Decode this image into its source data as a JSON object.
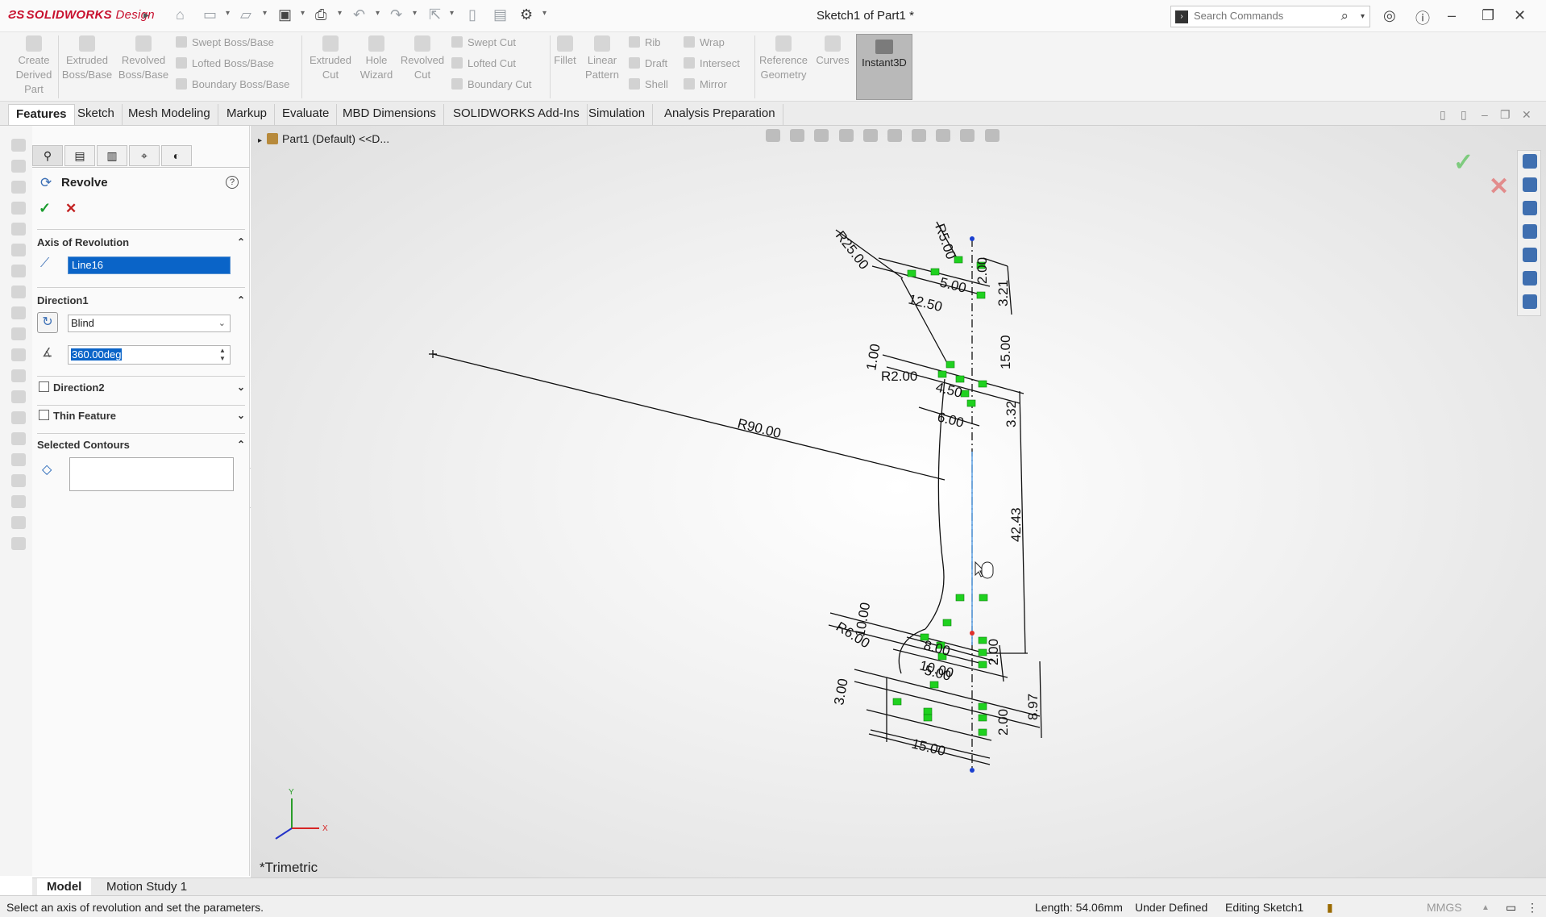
{
  "app": {
    "logo": "SOLIDWORKS",
    "logo_suffix": "Design",
    "document_title": "Sketch1 of Part1 *"
  },
  "search": {
    "placeholder": "Search Commands"
  },
  "ribbon": {
    "create_derived": "Create Derived Part",
    "extruded_boss": "Extruded Boss/Base",
    "revolved_boss": "Revolved Boss/Base",
    "swept_boss": "Swept Boss/Base",
    "lofted_boss": "Lofted Boss/Base",
    "boundary_boss": "Boundary Boss/Base",
    "extruded_cut": "Extruded Cut",
    "hole_wizard": "Hole Wizard",
    "revolved_cut": "Revolved Cut",
    "swept_cut": "Swept Cut",
    "lofted_cut": "Lofted Cut",
    "boundary_cut": "Boundary Cut",
    "fillet": "Fillet",
    "linear_pattern": "Linear Pattern",
    "rib": "Rib",
    "draft": "Draft",
    "shell": "Shell",
    "wrap": "Wrap",
    "intersect": "Intersect",
    "mirror": "Mirror",
    "reference_geometry": "Reference Geometry",
    "curves": "Curves",
    "instant3d": "Instant3D"
  },
  "tabs": [
    "Features",
    "Sketch",
    "Mesh Modeling",
    "Markup",
    "Evaluate",
    "MBD Dimensions",
    "SOLIDWORKS Add-Ins",
    "Simulation",
    "Analysis Preparation"
  ],
  "property_manager": {
    "title": "Revolve",
    "axis_section": "Axis of Revolution",
    "axis_value": "Line16",
    "direction1_section": "Direction1",
    "end_condition": "Blind",
    "angle": "360.00deg",
    "direction2_label": "Direction2",
    "thin_feature_label": "Thin Feature",
    "selected_contours_section": "Selected Contours"
  },
  "graphics": {
    "tree_root": "Part1 (Default) <<D...",
    "view_label": "*Trimetric",
    "triad": {
      "x": "X",
      "y": "Y"
    },
    "dimensions": [
      "R25.00",
      "R5.00",
      "5.00",
      "12.50",
      "2.00",
      "3.21",
      "15.00",
      "1.00",
      "R2.00",
      "4.50",
      "3.32",
      "6.00",
      "R90.00",
      "42.43",
      "R6.00",
      "10.00",
      "8.00",
      "10.00",
      "5.00",
      "2.00",
      "3.00",
      "2.00",
      "8.97",
      "15.00"
    ]
  },
  "bottom_tabs": [
    "Model",
    "Motion Study 1"
  ],
  "status": {
    "message": "Select an axis of revolution and set the parameters.",
    "length": "Length: 54.06mm",
    "definition": "Under Defined",
    "editing": "Editing Sketch1",
    "units": "MMGS"
  },
  "colors": {
    "accent": "#0a64c8",
    "brand": "#c8102e",
    "sketch_relation": "#22cc22"
  }
}
